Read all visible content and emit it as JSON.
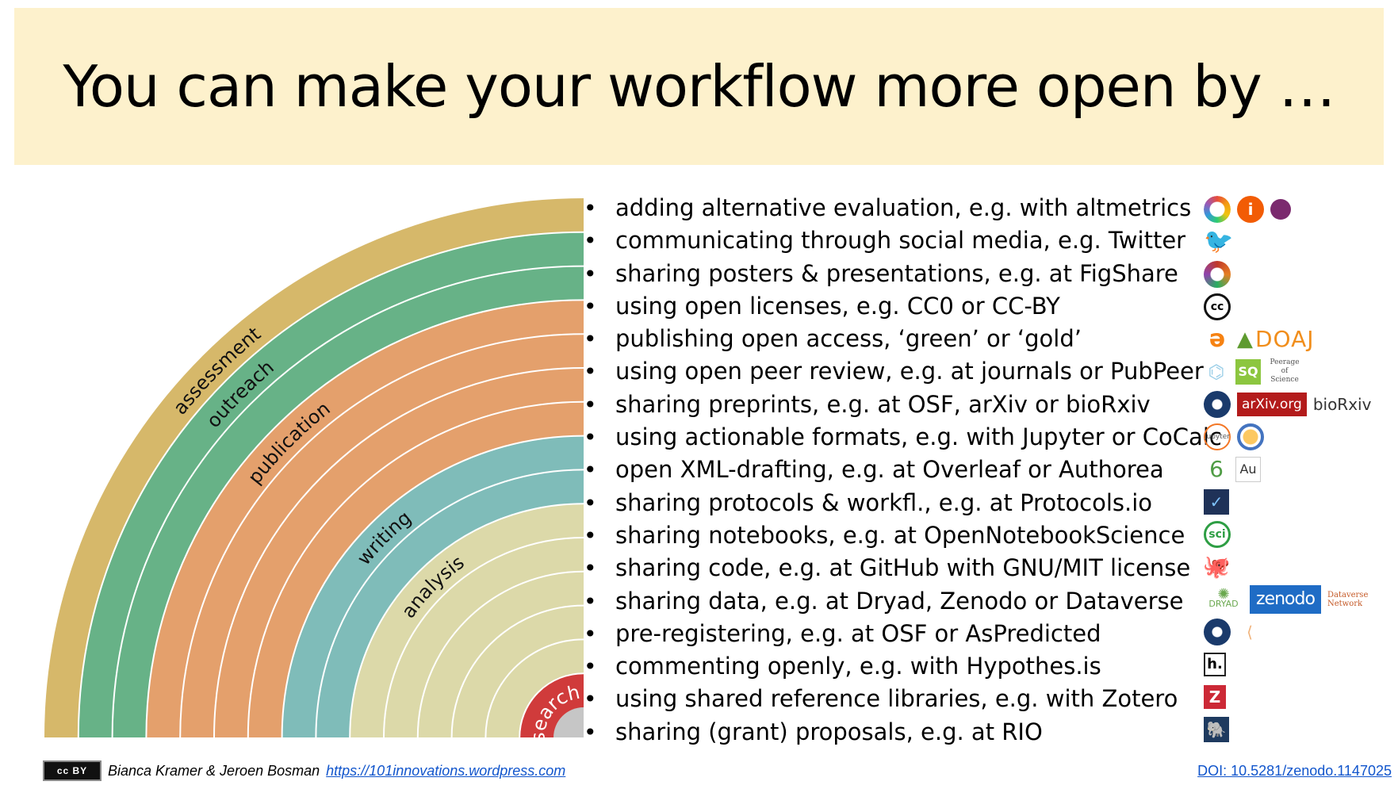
{
  "title": "You can make your workflow more open by …",
  "diagram": {
    "layers": [
      {
        "name": "assessment",
        "color": "#d6b86a",
        "rings": 1
      },
      {
        "name": "outreach",
        "color": "#67b287",
        "rings": 2
      },
      {
        "name": "publication",
        "color": "#e4a06c",
        "rings": 4
      },
      {
        "name": "writing",
        "color": "#7fbcb9",
        "rings": 2
      },
      {
        "name": "analysis",
        "color": "#dcd9a9",
        "rings": 5
      },
      {
        "name": "search",
        "color": "#d03b3b",
        "rings": 1
      }
    ],
    "core_color": "#c6c6c6"
  },
  "practices": [
    "adding alternative evaluation, e.g. with altmetrics",
    "communicating through social media, e.g. Twitter",
    "sharing posters & presentations, e.g. at FigShare",
    "using open licenses, e.g. CC0 or CC-BY",
    "publishing open access, ‘green’ or ‘gold’",
    "using open peer review, e.g. at journals or PubPeer",
    "sharing preprints, e.g. at OSF, arXiv or bioRxiv",
    "using actionable formats, e.g. with Jupyter or CoCalc",
    "open XML-drafting, e.g. at Overleaf or Authorea",
    "sharing protocols & workfl., e.g. at Protocols.io",
    "sharing notebooks, e.g. at OpenNotebookScience",
    "sharing code, e.g. at GitHub with GNU/MIT license",
    "sharing data, e.g. at Dryad, Zenodo or Dataverse",
    "pre-registering, e.g. at OSF or AsPredicted",
    "commenting openly, e.g. with Hypothes.is",
    "using shared reference libraries, e.g. with Zotero",
    "sharing (grant) proposals, e.g. at RIO"
  ],
  "logos": {
    "doaj": "DOAJ",
    "peerage": "Peerage of Science",
    "sq": "SQ",
    "arxiv": "arXiv.org",
    "biorxiv": "bioRxiv",
    "jupyter": "jupyter",
    "authorea": "Au",
    "sci": "sci",
    "dryad": "DRYAD",
    "zenodo": "zenodo",
    "dataverse": "Dataverse Network",
    "hypothesis": "h.",
    "zotero": "Z"
  },
  "footer": {
    "license_badge": "cc BY",
    "authors": "Bianca Kramer & Jeroen Bosman",
    "link": "https://101innovations.wordpress.com",
    "doi": "DOI: 10.5281/zenodo.1147025"
  }
}
